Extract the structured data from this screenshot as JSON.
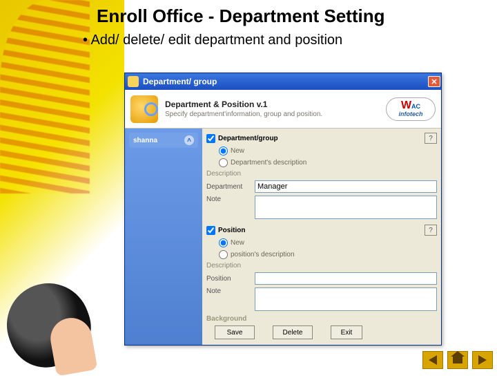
{
  "slide": {
    "title": "Enroll Office - Department Setting",
    "bullet": "Add/ delete/ edit department and position"
  },
  "window": {
    "title": "Department/ group",
    "banner": {
      "title": "Department & Position  v.1",
      "subtitle": "Specify department'information, group and position.",
      "logo_text_a": "W",
      "logo_text_b": "AC",
      "logo_text_c": "infotech"
    },
    "sidebar": {
      "group": "shanna"
    },
    "sections": {
      "dept": {
        "label": "Department/group",
        "checked": true,
        "radio_new": "New",
        "radio_desc": "Department's description",
        "fs_label": "Description",
        "field_label": "Department",
        "field_value": "Manager",
        "note_label": "Note",
        "note_value": ""
      },
      "pos": {
        "label": "Position",
        "checked": true,
        "radio_new": "New",
        "radio_desc": "position's description",
        "fs_label": "Description",
        "field_label": "Position",
        "field_value": "",
        "note_label": "Note",
        "note_value": ""
      },
      "background_label": "Background"
    },
    "buttons": {
      "save": "Save",
      "delete": "Delete",
      "exit": "Exit"
    },
    "help": "?"
  },
  "nav": {
    "prev": "prev",
    "home": "home",
    "next": "next"
  }
}
